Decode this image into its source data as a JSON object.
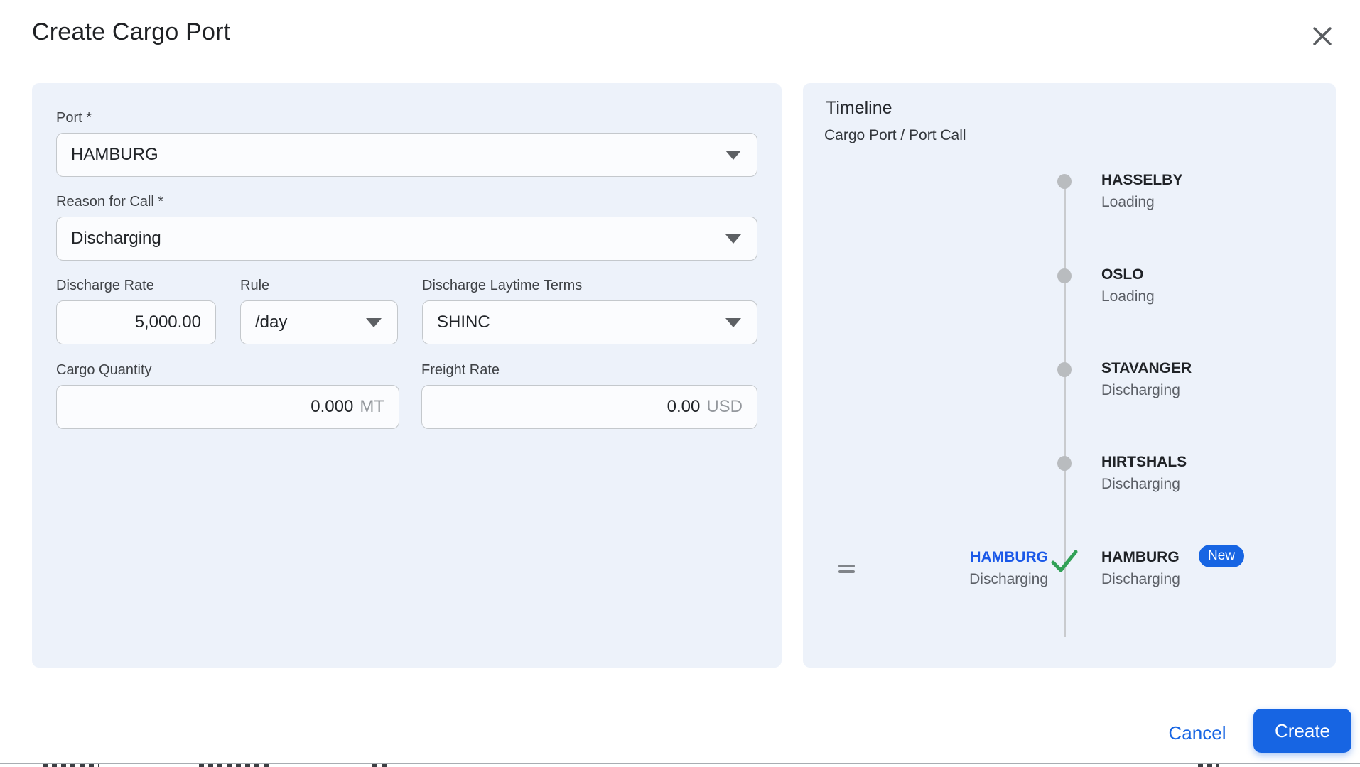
{
  "dialog": {
    "title": "Create Cargo Port"
  },
  "form": {
    "port_label": "Port *",
    "port_value": "HAMBURG",
    "reason_label": "Reason for Call *",
    "reason_value": "Discharging",
    "discharge_rate_label": "Discharge Rate",
    "discharge_rate_value": "5,000.00",
    "rule_label": "Rule",
    "rule_value": "/day",
    "laytime_label": "Discharge Laytime Terms",
    "laytime_value": "SHINC",
    "cargo_quantity_label": "Cargo Quantity",
    "cargo_quantity_value": "0.000",
    "cargo_quantity_unit": "MT",
    "freight_rate_label": "Freight Rate",
    "freight_rate_value": "0.00",
    "freight_rate_unit": "USD"
  },
  "timeline": {
    "title": "Timeline",
    "subtitle": "Cargo Port / Port Call",
    "entries": [
      {
        "port": "HASSELBY",
        "status": "Loading"
      },
      {
        "port": "OSLO",
        "status": "Loading"
      },
      {
        "port": "STAVANGER",
        "status": "Discharging"
      },
      {
        "port": "HIRTSHALS",
        "status": "Discharging"
      }
    ],
    "new_entry": {
      "cargo_port": "HAMBURG",
      "cargo_port_status": "Discharging",
      "port_call": "HAMBURG",
      "port_call_status": "Discharging",
      "badge": "New"
    }
  },
  "footer": {
    "cancel_label": "Cancel",
    "create_label": "Create"
  },
  "icons": {
    "close": "close-x",
    "dropdown": "chevron-down",
    "drag": "drag-handle",
    "check": "checkmark",
    "dot": "timeline-dot"
  },
  "colors": {
    "accent_blue": "#1765e3",
    "link_blue": "#1a58e8",
    "success_green": "#31a156",
    "panel_bg": "#edf2fa",
    "dot_gray": "#b9bcbf"
  }
}
